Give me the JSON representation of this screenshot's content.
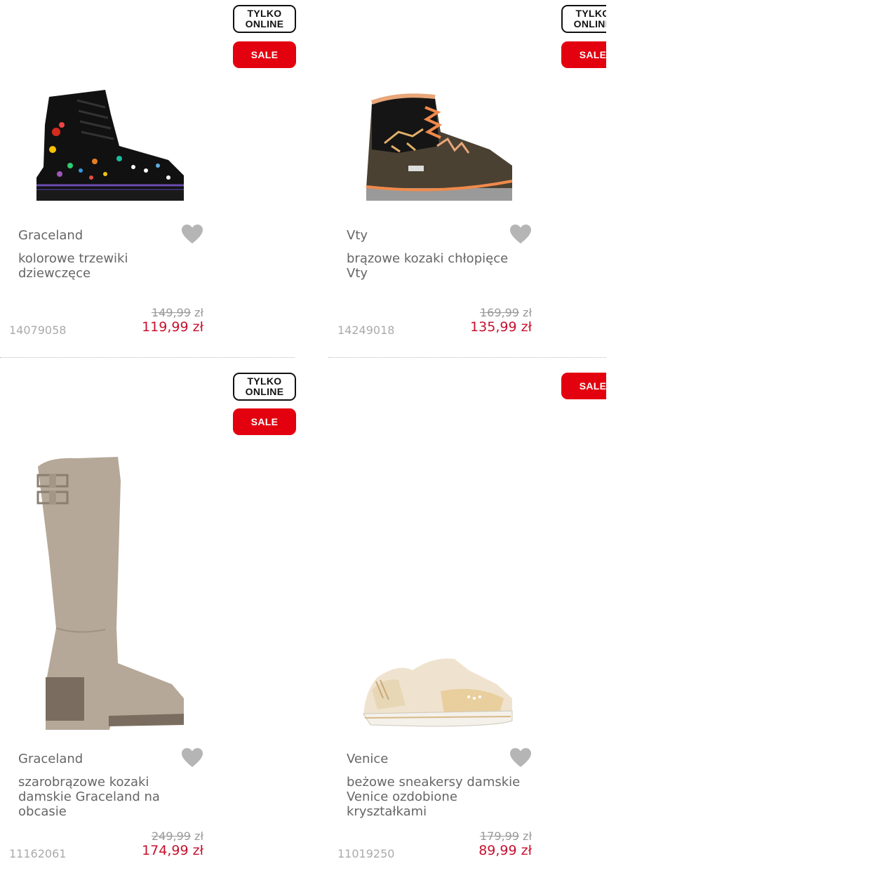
{
  "badges": {
    "online_line1": "TYLKO",
    "online_line2": "ONLINE",
    "sale": "SALE"
  },
  "products": [
    {
      "brand": "Graceland",
      "title": "kolorowe trzewiki dziewczęce",
      "old_price": "149,99",
      "old_currency": "zł",
      "new_price": "119,99 zł",
      "sku": "14079058"
    },
    {
      "brand": "Vty",
      "title": "brązowe kozaki chłopięce Vty",
      "old_price": "169,99",
      "old_currency": "zł",
      "new_price": "135,99 zł",
      "sku": "14249018"
    },
    {
      "brand": "Graceland",
      "title": "szarobrązowe kozaki damskie Graceland na obcasie",
      "old_price": "249,99",
      "old_currency": "zł",
      "new_price": "174,99 zł",
      "sku": "11162061"
    },
    {
      "brand": "Venice",
      "title": "beżowe sneakersy damskie Venice ozdobione kryształkami",
      "old_price": "179,99",
      "old_currency": "zł",
      "new_price": "89,99 zł",
      "sku": "11019250"
    }
  ],
  "colors": {
    "sale_red": "#e3000f",
    "price_red": "#c8102e",
    "heart_grey": "#b5b5b5"
  },
  "icons": {
    "favorite": "heart-icon"
  }
}
